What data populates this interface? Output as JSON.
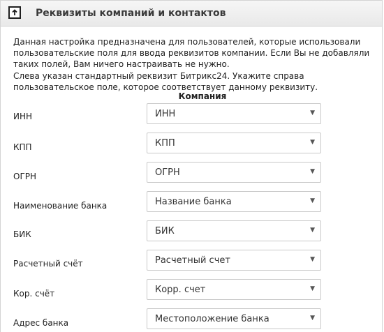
{
  "header": {
    "title": "Реквизиты компаний и контактов",
    "icon": "upload-icon"
  },
  "description": {
    "paragraph1": "Данная настройка предназначена для пользователей, которые использовали пользовательские поля для ввода реквизитов компании. Если Вы не добавляли таких полей, Вам ничего настраивать не нужно.",
    "paragraph2": "Слева указан стандартный реквизит Битрикс24. Укажите справа пользовательское поле, которое соответствует данному реквизиту."
  },
  "column_header": "Компания",
  "rows": [
    {
      "label": "ИНН",
      "value": "ИНН"
    },
    {
      "label": "КПП",
      "value": "КПП"
    },
    {
      "label": "ОГРН",
      "value": "ОГРН"
    },
    {
      "label": "Наименование банка",
      "value": "Название банка"
    },
    {
      "label": "БИК",
      "value": "БИК"
    },
    {
      "label": "Расчетный счёт",
      "value": "Расчетный счет"
    },
    {
      "label": "Кор. счёт",
      "value": "Корр. счет"
    },
    {
      "label": "Адрес банка",
      "value": "Местоположение банка"
    }
  ],
  "dropdown_arrow": "▼"
}
